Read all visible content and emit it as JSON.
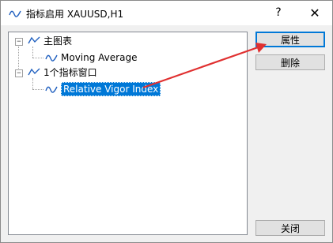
{
  "window": {
    "title": "指标启用 XAUUSD,H1",
    "help_label": "?",
    "close_label": "✕"
  },
  "tree": {
    "main_chart": {
      "label": "主图表",
      "expander": "−",
      "children": [
        {
          "label": "Moving Average"
        }
      ]
    },
    "indicator_window": {
      "label": "1个指标窗口",
      "expander": "−",
      "children": [
        {
          "label": "Relative Vigor Index",
          "selected": true
        }
      ]
    }
  },
  "buttons": {
    "properties": "属性",
    "delete": "删除",
    "close": "关闭"
  },
  "colors": {
    "selection": "#0078d7",
    "annotation_arrow": "#e03030",
    "chart_icon": "#1f5fbf"
  }
}
